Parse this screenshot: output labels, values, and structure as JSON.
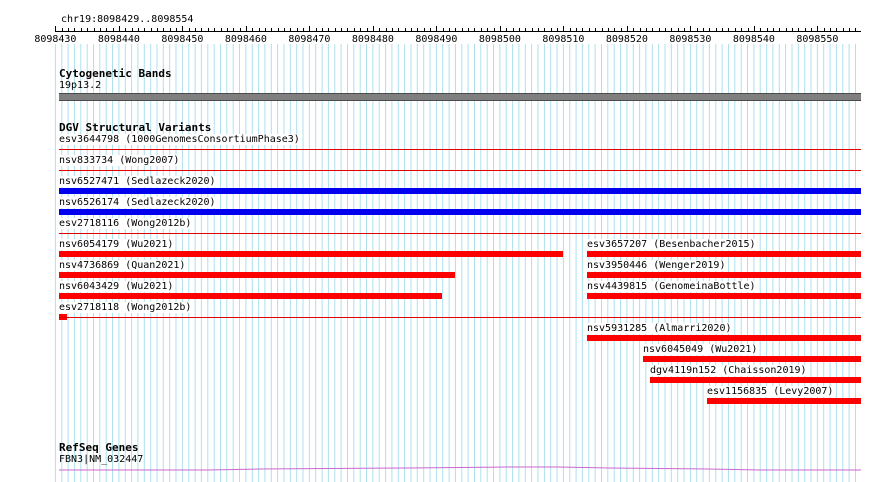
{
  "ruler": {
    "title": "chr19:8098429..8098554",
    "ticks": [
      "8098430",
      "8098440",
      "8098450",
      "8098460",
      "8098470",
      "8098480",
      "8098490",
      "8098500",
      "8098510",
      "8098520",
      "8098530",
      "8098540",
      "8098550"
    ]
  },
  "cyto": {
    "title": "Cytogenetic Bands",
    "band": "19p13.2",
    "band_color": "#7f7f7f"
  },
  "dgv": {
    "title": "DGV Structural Variants",
    "colors": {
      "loss": "#ff0000",
      "gain": "#0000ee"
    },
    "left_items": [
      {
        "label": "esv3644798 (1000GenomesConsortiumPhase3)",
        "style": "thin"
      },
      {
        "label": "nsv833734 (Wong2007)",
        "style": "thin"
      },
      {
        "label": "nsv6527471 (Sedlazeck2020)",
        "style": "blue"
      },
      {
        "label": "nsv6526174 (Sedlazeck2020)",
        "style": "blue"
      },
      {
        "label": "esv2718116 (Wong2012b)",
        "style": "thin"
      },
      {
        "label": "nsv6054179 (Wu2021)",
        "style": "red"
      },
      {
        "label": "nsv4736869 (Quan2021)",
        "style": "red"
      },
      {
        "label": "nsv6043429 (Wu2021)",
        "style": "red"
      },
      {
        "label": "esv2718118 (Wong2012b)",
        "style": "small"
      }
    ],
    "right_items": [
      {
        "label": "esv3657207 (Besenbacher2015)"
      },
      {
        "label": "nsv3950446 (Wenger2019)"
      },
      {
        "label": "nsv4439815 (GenomeinaBottle)"
      },
      {
        "label": "nsv5931285 (Almarri2020)"
      },
      {
        "label": "nsv6045049 (Wu2021)"
      },
      {
        "label": "dgv4119n152 (Chaisson2019)"
      },
      {
        "label": "esv1156835 (Levy2007)"
      }
    ]
  },
  "refseq": {
    "title": "RefSeq Genes",
    "gene": "FBN3|NM_032447",
    "gene_color": "#cc66cc"
  },
  "grid_color": "#aee0ee"
}
